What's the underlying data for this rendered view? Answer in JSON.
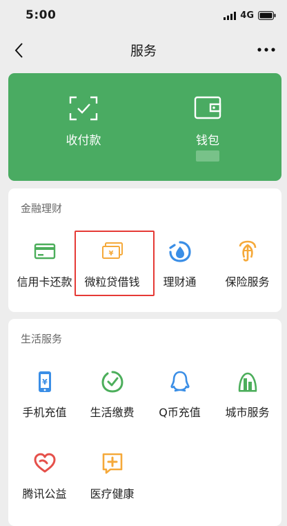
{
  "status_bar": {
    "time": "5:00",
    "network": "4G"
  },
  "nav": {
    "title": "服务"
  },
  "pay_card": {
    "items": [
      {
        "label": "收付款",
        "icon": "qr-scan-icon"
      },
      {
        "label": "钱包",
        "icon": "wallet-icon"
      }
    ]
  },
  "finance": {
    "title": "金融理财",
    "items": [
      {
        "label": "信用卡还款",
        "icon": "credit-card-icon"
      },
      {
        "label": "微粒贷借钱",
        "icon": "yuan-bill-icon"
      },
      {
        "label": "理财通",
        "icon": "finance-drop-icon"
      },
      {
        "label": "保险服务",
        "icon": "umbrella-insurance-icon"
      }
    ]
  },
  "life": {
    "title": "生活服务",
    "items": [
      {
        "label": "手机充值",
        "icon": "phone-recharge-icon"
      },
      {
        "label": "生活缴费",
        "icon": "bill-payment-icon"
      },
      {
        "label": "Q币充值",
        "icon": "qq-penguin-icon"
      },
      {
        "label": "城市服务",
        "icon": "city-building-icon"
      },
      {
        "label": "腾讯公益",
        "icon": "charity-heart-icon"
      },
      {
        "label": "医疗健康",
        "icon": "medical-plus-icon"
      }
    ]
  },
  "colors": {
    "accent_green": "#4aab62",
    "highlight_red": "#e53935",
    "icon_green": "#4cae5b",
    "icon_orange": "#f5a93a",
    "icon_blue": "#3a8ee6",
    "icon_red": "#e5504a"
  }
}
